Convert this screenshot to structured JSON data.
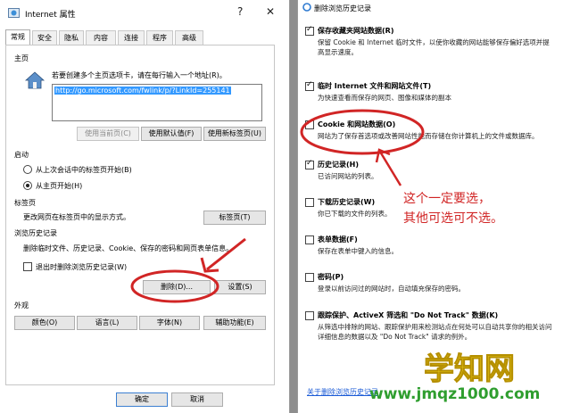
{
  "left_dialog": {
    "title": "Internet 属性",
    "help_glyph": "?",
    "close_glyph": "✕",
    "tabs": [
      "常规",
      "安全",
      "隐私",
      "内容",
      "连接",
      "程序",
      "高级"
    ],
    "home": {
      "section": "主页",
      "hint": "若要创建多个主页选项卡，请在每行输入一个地址(R)。",
      "url": "http://go.microsoft.com/fwlink/p/?LinkId=255141",
      "btn_current": "使用当前页(C)",
      "btn_default": "使用默认值(F)",
      "btn_newtab": "使用新标签页(U)"
    },
    "startup": {
      "section": "启动",
      "opt_last": "从上次会话中的标签页开始(B)",
      "opt_home": "从主页开始(H)",
      "selected": "opt_home"
    },
    "tabs_section": {
      "section": "标签页",
      "desc": "更改网页在标签页中的显示方式。",
      "btn": "标签页(T)"
    },
    "history": {
      "section": "浏览历史记录",
      "desc": "删除临时文件、历史记录、Cookie、保存的密码和网页表单信息。",
      "chk_delete_on_exit": "退出时删除浏览历史记录(W)",
      "chk_checked": false,
      "btn_delete": "删除(D)...",
      "btn_settings": "设置(S)"
    },
    "appearance": {
      "section": "外观",
      "btn_colors": "颜色(O)",
      "btn_lang": "语言(L)",
      "btn_fonts": "字体(N)",
      "btn_access": "辅助功能(E)"
    },
    "footer": {
      "ok": "确定",
      "cancel": "取消"
    }
  },
  "right_dialog": {
    "title": "删除浏览历史记录",
    "items": [
      {
        "title": "保存收藏夹网站数据(R)",
        "desc": "保留 Cookie 和 Internet 临时文件，以使你收藏的网站能够保存偏好选项并提高显示速度。",
        "checked": true
      },
      {
        "title": "临时 Internet 文件和网站文件(T)",
        "desc": "为快速查看而保存的网页、图像和媒体的副本",
        "checked": true
      },
      {
        "title": "Cookie 和网站数据(O)",
        "desc": "网站为了保存首选项或改善网站性能而存储在你计算机上的文件或数据库。",
        "checked": true
      },
      {
        "title": "历史记录(H)",
        "desc": "已访问网站的列表。",
        "checked": true
      },
      {
        "title": "下载历史记录(W)",
        "desc": "你已下载的文件的列表。",
        "checked": false
      },
      {
        "title": "表单数据(F)",
        "desc": "保存在表单中键入的信息。",
        "checked": false
      },
      {
        "title": "密码(P)",
        "desc": "登录以前访问过的网站时，自动填充保存的密码。",
        "checked": false
      },
      {
        "title": "跟踪保护、ActiveX 筛选和 \"Do Not Track\" 数据(K)",
        "desc": "从筛选中排除的网站、跟踪保护用来检测站点在何处可以自动共享你的相关访问详细信息的数据以及 \"Do Not Track\" 请求的例外。",
        "checked": false
      }
    ],
    "link": "关于删除浏览历史记录"
  },
  "annotation": {
    "line1": "这个一定要选，",
    "line2": "其他可选可不选。"
  },
  "watermark": {
    "brand": "学知网",
    "url": "www.jmqz1000.com"
  },
  "colors": {
    "annotation_red": "#d12525",
    "watermark_yellow": "#f2d21a",
    "watermark_green": "#2f9e2f",
    "selection_blue": "#3399ff"
  }
}
